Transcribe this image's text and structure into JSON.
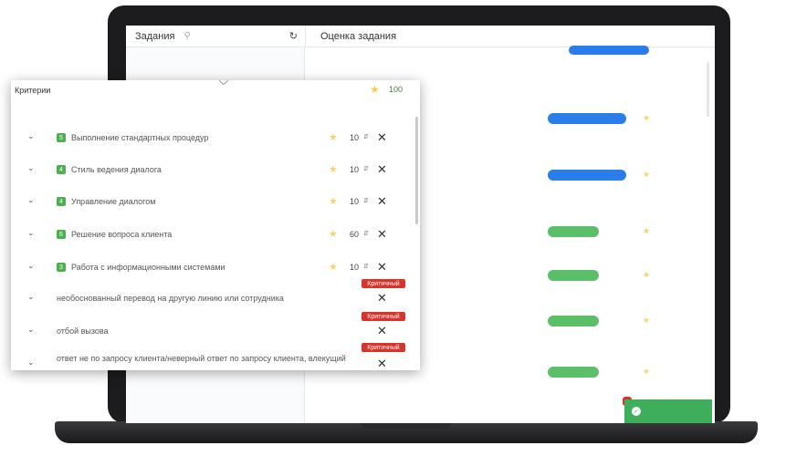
{
  "left_panel": {
    "title": "Задания",
    "search_icon": "search-icon",
    "refresh_icon": "refresh-icon"
  },
  "right_panel": {
    "title": "Оценка задания"
  },
  "popup": {
    "title": "Критерии",
    "total_score": "100",
    "criteria": [
      {
        "badge": "5",
        "label": "Выполнение стандартных процедур",
        "value": "10"
      },
      {
        "badge": "4",
        "label": "Стиль ведения диалога",
        "value": "10"
      },
      {
        "badge": "4",
        "label": "Управление диалогом",
        "value": "10"
      },
      {
        "badge": "6",
        "label": "Решение вопроса клиента",
        "value": "60"
      },
      {
        "badge": "3",
        "label": "Работа с информационными системами",
        "value": "10"
      }
    ],
    "critical_label": "Критичный",
    "critical_items": [
      {
        "label": "необоснованный перевод на другую линию или сотрудника"
      },
      {
        "label": "отбой вызова"
      },
      {
        "label": "ответ не по запросу клиента/неверный ответ по запросу клиента, влекущий"
      }
    ]
  },
  "colors": {
    "accent_blue": "#2b7de9",
    "green": "#4caf50",
    "critical_red": "#d9342b",
    "star": "#f5d46a"
  }
}
